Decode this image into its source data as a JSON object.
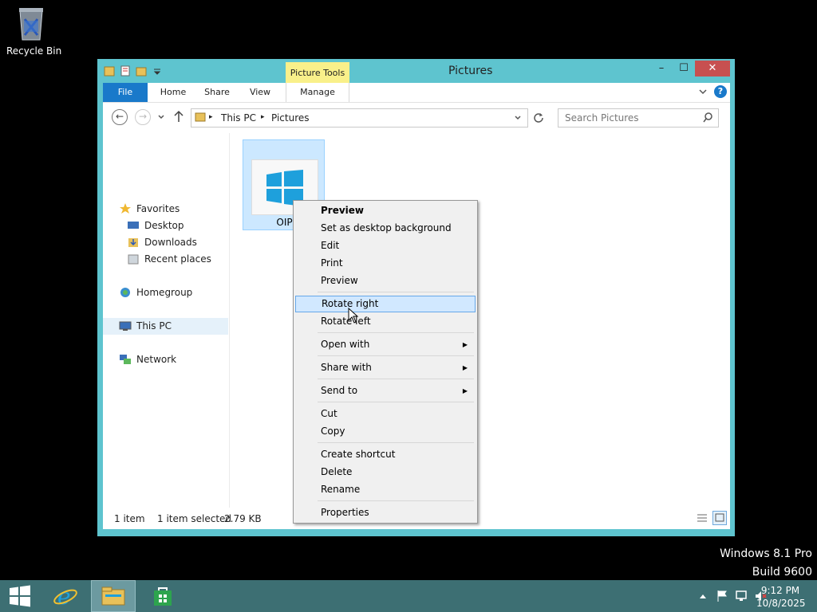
{
  "desktop": {
    "recycle_bin_label": "Recycle Bin"
  },
  "window": {
    "title": "Pictures",
    "contextual_tab_group": "Picture Tools",
    "controls": {
      "minimize": "–",
      "maximize": "☐",
      "close": "✕"
    },
    "ribbon_tabs": [
      "File",
      "Home",
      "Share",
      "View",
      "Manage"
    ],
    "help_label": "?",
    "address": {
      "segments": [
        "This PC",
        "Pictures"
      ],
      "separator": "▸"
    },
    "search_placeholder": "Search Pictures",
    "nav": {
      "favorites": "Favorites",
      "desktop": "Desktop",
      "downloads": "Downloads",
      "recent": "Recent places",
      "homegroup": "Homegroup",
      "this_pc": "This PC",
      "network": "Network"
    },
    "file": {
      "name": "OIP"
    },
    "status": {
      "item_count": "1 item",
      "selected": "1 item selected",
      "size": "2.79 KB"
    }
  },
  "context_menu": {
    "items": [
      "Preview",
      "Set as desktop background",
      "Edit",
      "Print",
      "Preview",
      "Rotate right",
      "Rotate left",
      "Open with",
      "Share with",
      "Send to",
      "Cut",
      "Copy",
      "Create shortcut",
      "Delete",
      "Rename",
      "Properties"
    ],
    "highlighted": "Rotate right",
    "submenu_arrow": "▶"
  },
  "watermark": {
    "line1": "Windows 8.1 Pro",
    "line2": "Build 9600"
  },
  "taskbar": {
    "time": "9:12 PM",
    "date": "10/8/2025"
  },
  "colors": {
    "window_frame": "#5ec4cf",
    "file_tab": "#1979ca",
    "picture_tools": "#f9f08a",
    "close_button": "#c75050",
    "taskbar": "#3d6f73",
    "selection": "#cce8ff"
  }
}
